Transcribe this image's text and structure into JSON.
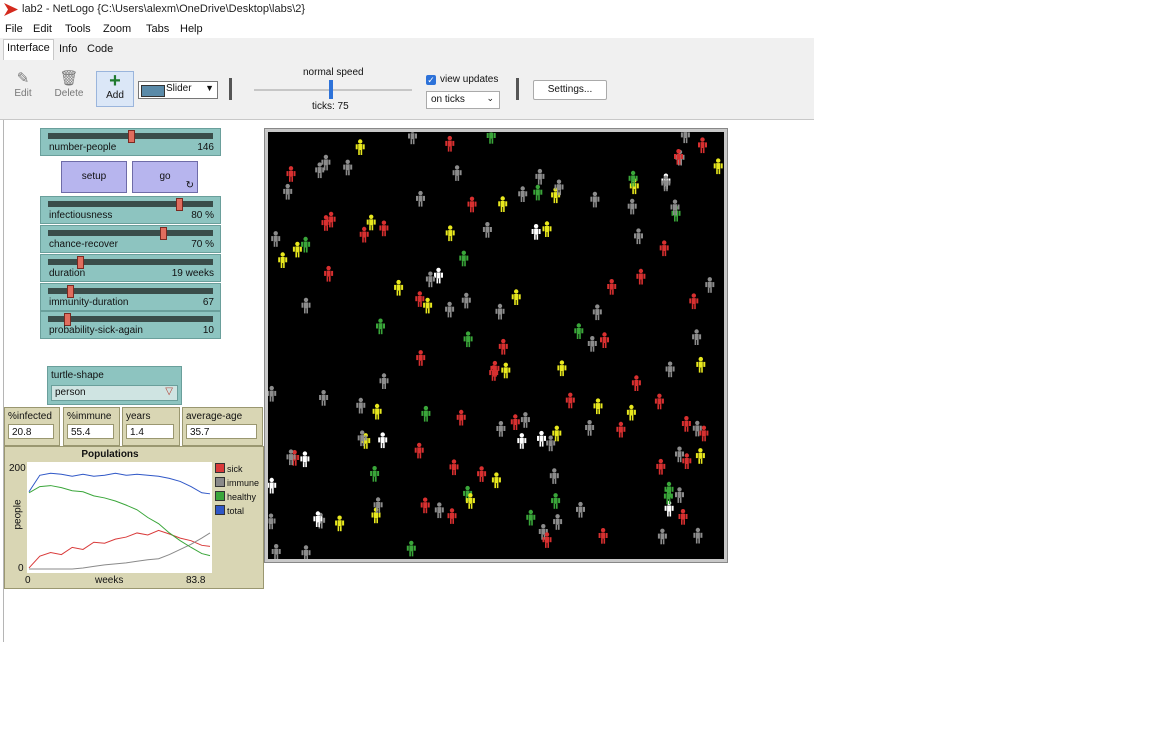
{
  "window": {
    "title": "lab2 - NetLogo {C:\\Users\\alexm\\OneDrive\\Desktop\\labs\\2}"
  },
  "menu": [
    "File",
    "Edit",
    "Tools",
    "Zoom",
    "Tabs",
    "Help"
  ],
  "tabs": [
    "Interface",
    "Info",
    "Code"
  ],
  "toolbar": {
    "edit_label": "Edit",
    "delete_label": "Delete",
    "add_label": "Add",
    "widget_type": "Slider",
    "speed_label": "normal speed",
    "ticks_label": "ticks: 75",
    "view_updates_label": "view updates",
    "update_mode": "on ticks",
    "settings_label": "Settings..."
  },
  "sliders": [
    {
      "name": "number-people",
      "value": "146",
      "level": 0.5
    },
    {
      "name": "infectiousness",
      "value": "80 %",
      "level": 0.8
    },
    {
      "name": "chance-recover",
      "value": "70 %",
      "level": 0.7
    },
    {
      "name": "duration",
      "value": "19 weeks",
      "level": 0.18
    },
    {
      "name": "immunity-duration",
      "value": "67",
      "level": 0.12
    },
    {
      "name": "probability-sick-again",
      "value": "10",
      "level": 0.1
    }
  ],
  "buttons": {
    "setup": "setup",
    "go": "go",
    "forever_icon": "↻"
  },
  "chooser": {
    "name": "turtle-shape",
    "value": "person"
  },
  "monitors": [
    {
      "name": "%infected",
      "value": "20.8"
    },
    {
      "name": "%immune",
      "value": "55.4"
    },
    {
      "name": "years",
      "value": "1.4"
    },
    {
      "name": "average-age",
      "value": "35.7"
    }
  ],
  "chart_data": {
    "type": "line",
    "title": "Populations",
    "xlabel": "weeks",
    "ylabel": "people",
    "xlim": [
      0,
      83.8
    ],
    "ylim": [
      0,
      200
    ],
    "x_tick_labels": [
      "0",
      "83.8"
    ],
    "y_tick_labels": [
      "0",
      "200"
    ],
    "legend_position": "right",
    "grid": false,
    "series": [
      {
        "name": "sick",
        "color": "#d93a3a",
        "x": [
          0,
          5,
          10,
          15,
          20,
          25,
          30,
          35,
          40,
          45,
          50,
          55,
          60,
          65,
          70,
          75,
          80,
          83.8
        ],
        "y": [
          2,
          25,
          32,
          28,
          42,
          38,
          52,
          50,
          58,
          62,
          70,
          66,
          75,
          68,
          60,
          55,
          46,
          44
        ]
      },
      {
        "name": "immune",
        "color": "#8a8a8a",
        "x": [
          0,
          10,
          20,
          25,
          30,
          35,
          40,
          45,
          50,
          55,
          60,
          65,
          70,
          75,
          80,
          83.8
        ],
        "y": [
          0,
          0,
          0,
          2,
          5,
          8,
          10,
          12,
          15,
          18,
          20,
          28,
          38,
          48,
          60,
          70
        ]
      },
      {
        "name": "healthy",
        "color": "#3aa63a",
        "x": [
          0,
          5,
          10,
          15,
          20,
          25,
          30,
          35,
          40,
          45,
          50,
          55,
          60,
          65,
          70,
          75,
          80,
          83.8
        ],
        "y": [
          148,
          160,
          162,
          158,
          152,
          150,
          142,
          138,
          132,
          124,
          115,
          100,
          88,
          70,
          55,
          42,
          30,
          26
        ]
      },
      {
        "name": "total",
        "color": "#2f57c7",
        "x": [
          0,
          5,
          10,
          15,
          20,
          25,
          30,
          35,
          40,
          45,
          50,
          55,
          60,
          65,
          70,
          75,
          80,
          83.8
        ],
        "y": [
          150,
          182,
          186,
          184,
          180,
          184,
          180,
          182,
          186,
          182,
          184,
          182,
          180,
          176,
          170,
          160,
          148,
          146
        ]
      }
    ]
  }
}
